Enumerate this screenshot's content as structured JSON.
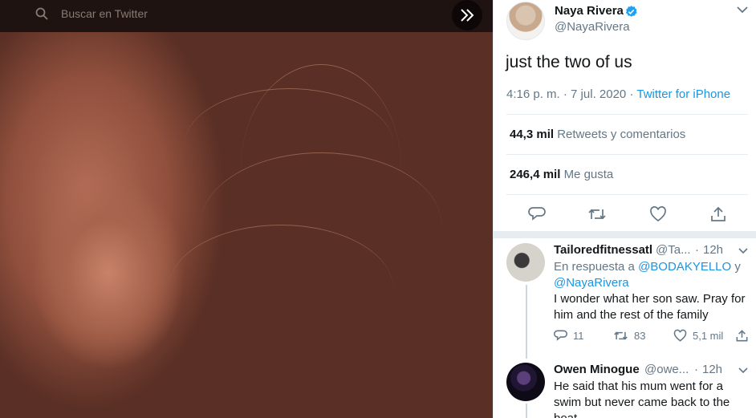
{
  "viewer": {
    "search_placeholder": "Buscar en Twitter",
    "icons": {
      "search": "search-icon",
      "collapse": "double-chevron-right-icon"
    }
  },
  "tweet": {
    "author_name": "Naya Rivera",
    "author_handle": "@NayaRivera",
    "verified": true,
    "text": "just the two of us",
    "time": "4:16 p. m.",
    "date": "7 jul. 2020",
    "separator": "·",
    "source": "Twitter for iPhone",
    "retweets_count": "44,3 mil",
    "retweets_label": "Retweets y comentarios",
    "likes_count": "246,4 mil",
    "likes_label": "Me gusta",
    "actions": [
      "reply-icon",
      "retweet-icon",
      "like-icon",
      "share-icon"
    ]
  },
  "replies": [
    {
      "name": "Tailoredfitnessatl",
      "handle": "@Ta...",
      "dot": "·",
      "time": "12h",
      "reply_prefix": "En respuesta a",
      "mention_1": "@BODAKYELLO",
      "conjunction": "y",
      "mention_2": "@NayaRivera",
      "text": "I wonder what her son saw. Pray for him and the rest of the family",
      "reply_count": "11",
      "retweet_count": "83",
      "like_count": "5,1 mil"
    },
    {
      "name": "Owen Minogue",
      "handle": "@owe...",
      "dot": "·",
      "time": "12h",
      "text": "He said that his mum went for a swim but never came back to the boat"
    }
  ],
  "colors": {
    "accent": "#1b95e0",
    "verified": "#1da1f2",
    "secondary_text": "#657786",
    "divider": "#e6ecf0"
  }
}
